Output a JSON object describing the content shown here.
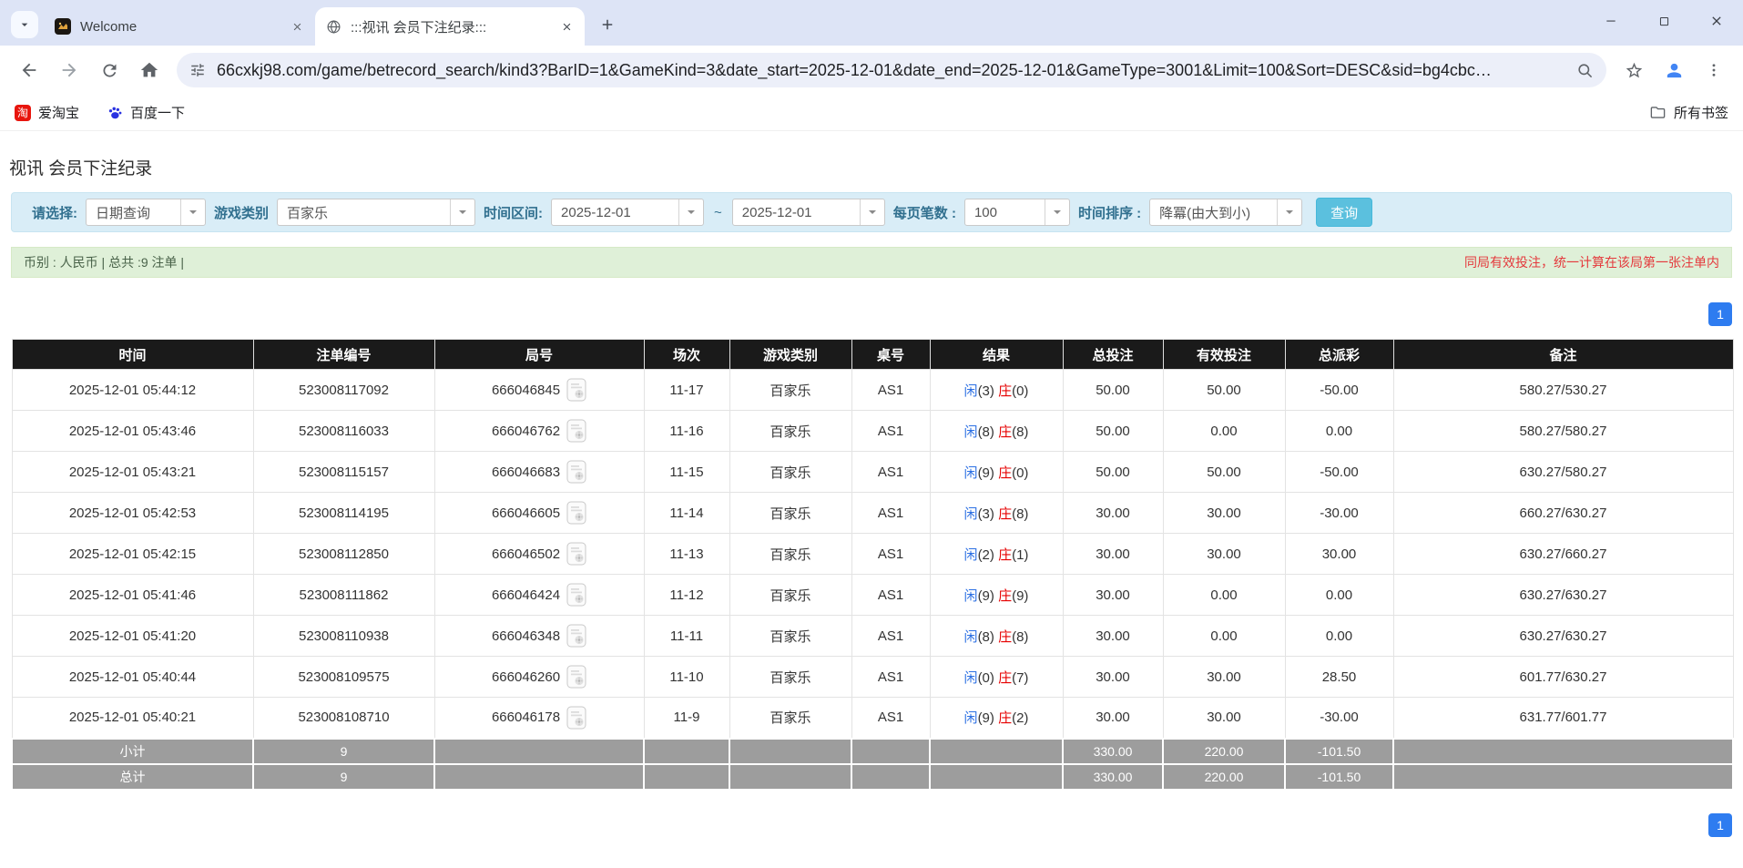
{
  "browser": {
    "tabs": [
      {
        "title": "Welcome"
      },
      {
        "title": ":::视讯 会员下注纪录:::"
      }
    ],
    "url": "66cxkj98.com/game/betrecord_search/kind3?BarID=1&GameKind=3&date_start=2025-12-01&date_end=2025-12-01&GameType=3001&Limit=100&Sort=DESC&sid=bg4cbc…",
    "bookmarks": [
      {
        "label": "爱淘宝",
        "icon_text": "淘"
      },
      {
        "label": "百度一下"
      }
    ],
    "bookmarks_right": "所有书签"
  },
  "page": {
    "title": "视讯 会员下注纪录",
    "filters": {
      "select_label": "请选择:",
      "select_value": "日期查询",
      "game_label": "游戏类别",
      "game_value": "百家乐",
      "range_label": "时间区间:",
      "date_start": "2025-12-01",
      "tilde": "~",
      "date_end": "2025-12-01",
      "per_page_label": "每页笔数 :",
      "per_page_value": "100",
      "sort_label": "时间排序 :",
      "sort_value": "降冪(由大到小)",
      "search_button": "查询"
    },
    "summary": {
      "left": "币别 : 人民币 | 总共 :9 注单 |",
      "right": "同局有效投注，统一计算在该局第一张注单内"
    },
    "pagination": "1",
    "table": {
      "headers": [
        "时间",
        "注单编号",
        "局号",
        "场次",
        "游戏类别",
        "桌号",
        "结果",
        "总投注",
        "有效投注",
        "总派彩",
        "备注"
      ],
      "rows": [
        {
          "time": "2025-12-01 05:44:12",
          "bet_no": "523008117092",
          "round_no": "666046845",
          "session": "11-17",
          "game_type": "百家乐",
          "table_no": "AS1",
          "result_player": "闲(3)",
          "result_banker": "庄(0)",
          "total_bet": "50.00",
          "valid_bet": "50.00",
          "payout": "-50.00",
          "remark": "580.27/530.27"
        },
        {
          "time": "2025-12-01 05:43:46",
          "bet_no": "523008116033",
          "round_no": "666046762",
          "session": "11-16",
          "game_type": "百家乐",
          "table_no": "AS1",
          "result_player": "闲(8)",
          "result_banker": "庄(8)",
          "total_bet": "50.00",
          "valid_bet": "0.00",
          "payout": "0.00",
          "remark": "580.27/580.27"
        },
        {
          "time": "2025-12-01 05:43:21",
          "bet_no": "523008115157",
          "round_no": "666046683",
          "session": "11-15",
          "game_type": "百家乐",
          "table_no": "AS1",
          "result_player": "闲(9)",
          "result_banker": "庄(0)",
          "total_bet": "50.00",
          "valid_bet": "50.00",
          "payout": "-50.00",
          "remark": "630.27/580.27"
        },
        {
          "time": "2025-12-01 05:42:53",
          "bet_no": "523008114195",
          "round_no": "666046605",
          "session": "11-14",
          "game_type": "百家乐",
          "table_no": "AS1",
          "result_player": "闲(3)",
          "result_banker": "庄(8)",
          "total_bet": "30.00",
          "valid_bet": "30.00",
          "payout": "-30.00",
          "remark": "660.27/630.27"
        },
        {
          "time": "2025-12-01 05:42:15",
          "bet_no": "523008112850",
          "round_no": "666046502",
          "session": "11-13",
          "game_type": "百家乐",
          "table_no": "AS1",
          "result_player": "闲(2)",
          "result_banker": "庄(1)",
          "total_bet": "30.00",
          "valid_bet": "30.00",
          "payout": "30.00",
          "remark": "630.27/660.27"
        },
        {
          "time": "2025-12-01 05:41:46",
          "bet_no": "523008111862",
          "round_no": "666046424",
          "session": "11-12",
          "game_type": "百家乐",
          "table_no": "AS1",
          "result_player": "闲(9)",
          "result_banker": "庄(9)",
          "total_bet": "30.00",
          "valid_bet": "0.00",
          "payout": "0.00",
          "remark": "630.27/630.27"
        },
        {
          "time": "2025-12-01 05:41:20",
          "bet_no": "523008110938",
          "round_no": "666046348",
          "session": "11-11",
          "game_type": "百家乐",
          "table_no": "AS1",
          "result_player": "闲(8)",
          "result_banker": "庄(8)",
          "total_bet": "30.00",
          "valid_bet": "0.00",
          "payout": "0.00",
          "remark": "630.27/630.27"
        },
        {
          "time": "2025-12-01 05:40:44",
          "bet_no": "523008109575",
          "round_no": "666046260",
          "session": "11-10",
          "game_type": "百家乐",
          "table_no": "AS1",
          "result_player": "闲(0)",
          "result_banker": "庄(7)",
          "total_bet": "30.00",
          "valid_bet": "30.00",
          "payout": "28.50",
          "remark": "601.77/630.27"
        },
        {
          "time": "2025-12-01 05:40:21",
          "bet_no": "523008108710",
          "round_no": "666046178",
          "session": "11-9",
          "game_type": "百家乐",
          "table_no": "AS1",
          "result_player": "闲(9)",
          "result_banker": "庄(2)",
          "total_bet": "30.00",
          "valid_bet": "30.00",
          "payout": "-30.00",
          "remark": "631.77/601.77"
        }
      ],
      "subtotal": {
        "label": "小计",
        "count": "9",
        "total_bet": "330.00",
        "valid_bet": "220.00",
        "payout": "-101.50"
      },
      "total": {
        "label": "总计",
        "count": "9",
        "total_bet": "330.00",
        "valid_bet": "220.00",
        "payout": "-101.50"
      }
    }
  },
  "colors": {
    "accent_cyan": "#5bc0de",
    "link_blue": "#2b6fe3",
    "negative_red": "#e60000",
    "header_black": "#1a1a1a",
    "filter_bg": "#d9edf7",
    "summary_bg": "#dff0d8",
    "pagination_blue": "#2e7cf0"
  }
}
